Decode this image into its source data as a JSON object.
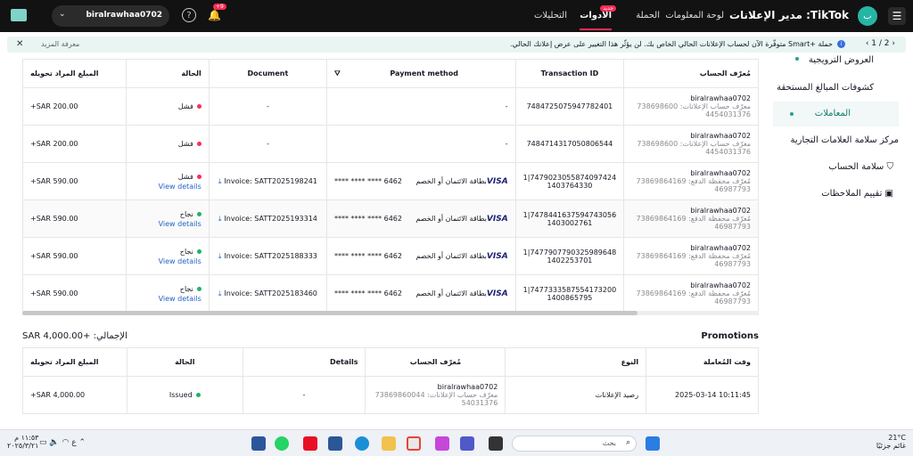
{
  "topbar": {
    "brand": "TikTok: مدير الإعلانات",
    "avatar_letter": "ب",
    "nav": [
      "لوحة المعلومات",
      "الحملة",
      "الأدوات",
      "التحليلات"
    ],
    "new_badge": "جديد",
    "bell_badge": "+9",
    "account_name": "biralrawhaa0702"
  },
  "notice": {
    "text": "حملة +Smart متوفّرة الآن لحساب الإعلانات الحالي الخاص بك. لن يؤثّر هذا التغيير على عرض إعلانك الحالي.",
    "more": "معرفة المزيد",
    "pager": "1 / 2"
  },
  "sidebar": {
    "items": [
      "العروض الترويجية",
      "كشوفات المبالغ المستحقة",
      "المعاملات",
      "مركز سلامة العلامات التجارية",
      "سلامة الحساب",
      "تقييم الملاحظات"
    ]
  },
  "table": {
    "headers": {
      "account": "مُعرّف الحساب",
      "tx": "Transaction ID",
      "pay": "Payment method",
      "doc": "Document",
      "status": "الحالة",
      "amount": "المبلغ المراد تحويله"
    },
    "view_details": "View details",
    "rows": [
      {
        "acct_name": "biralrawhaa0702",
        "acct_sub1": "معرّف حساب الإعلانات: 738698600",
        "acct_sub2": "4454031376",
        "tx": "7484725075947782401",
        "tx2": "",
        "pay": "-",
        "card": "",
        "doc": "-",
        "status": "فشل",
        "status_color": "#fe2c55",
        "details": false,
        "amount": "+SAR 200.00"
      },
      {
        "acct_name": "biralrawhaa0702",
        "acct_sub1": "معرّف حساب الإعلانات: 738698600",
        "acct_sub2": "4454031376",
        "tx": "7484714317050806544",
        "tx2": "",
        "pay": "-",
        "card": "",
        "doc": "-",
        "status": "فشل",
        "status_color": "#fe2c55",
        "details": false,
        "amount": "+SAR 200.00"
      },
      {
        "acct_name": "biralrawhaa0702",
        "acct_sub1": "مُعرّف محفظة الدفع: 73869864169",
        "acct_sub2": "46987793",
        "tx": "1|7479023055874097424",
        "tx2": "1403764330",
        "pay": "بطاقة الائتمان أو الخصم",
        "card": "**** **** **** 6462",
        "doc": "Invoice: SATT2025198241",
        "status": "فشل",
        "status_color": "#fe2c55",
        "details": true,
        "amount": "+SAR 590.00"
      },
      {
        "acct_name": "biralrawhaa0702",
        "acct_sub1": "مُعرّف محفظة الدفع: 73869864169",
        "acct_sub2": "46987793",
        "tx": "1|7478441637594743056",
        "tx2": "1403002761",
        "pay": "بطاقة الائتمان أو الخصم",
        "card": "**** **** **** 6462",
        "doc": "Invoice: SATT2025193314",
        "status": "نجاح",
        "status_color": "#20b26b",
        "details": true,
        "amount": "+SAR 590.00"
      },
      {
        "acct_name": "biralrawhaa0702",
        "acct_sub1": "مُعرّف محفظة الدفع: 73869864169",
        "acct_sub2": "46987793",
        "tx": "1|7477907790325989648",
        "tx2": "1402253701",
        "pay": "بطاقة الائتمان أو الخصم",
        "card": "**** **** **** 6462",
        "doc": "Invoice: SATT2025188333",
        "status": "نجاح",
        "status_color": "#20b26b",
        "details": true,
        "amount": "+SAR 590.00"
      },
      {
        "acct_name": "biralrawhaa0702",
        "acct_sub1": "مُعرّف محفظة الدفع: 73869864169",
        "acct_sub2": "46987793",
        "tx": "1|7477333587554173200",
        "tx2": "1400865795",
        "pay": "بطاقة الائتمان أو الخصم",
        "card": "**** **** **** 6462",
        "doc": "Invoice: SATT2025183460",
        "status": "نجاح",
        "status_color": "#20b26b",
        "details": true,
        "amount": "+SAR 590.00"
      }
    ]
  },
  "summary": {
    "total": "الإجمالي: +SAR 4,000.00",
    "promotions": "Promotions"
  },
  "promo_table": {
    "headers": [
      "وقت المُعاملة",
      "النوع",
      "مُعرّف الحساب",
      "Details",
      "الحالة",
      "المبلغ المراد تحويله"
    ],
    "row": {
      "time": "2025-03-14 10:11:45",
      "type": "رصيد الإعلانات",
      "acct_name": "biralrawhaa0702",
      "acct_sub1": "معرّف حساب الإعلانات: 73869860044",
      "acct_sub2": "54031376",
      "details": "-",
      "status": "Issued",
      "status_color": "#20b26b",
      "amount": "+SAR 4,000.00"
    }
  },
  "taskbar": {
    "search": "بحث",
    "temp": "21°C",
    "weather": "غائم جزئيًا",
    "time": "١١:٥٣ م",
    "date": "٢٠٢٥/٣/٢١",
    "lang": "ع"
  }
}
